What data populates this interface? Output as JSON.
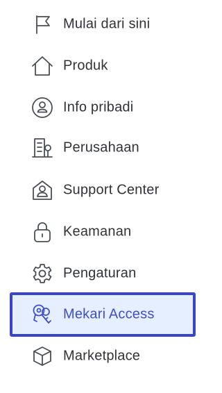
{
  "menu": {
    "items": [
      {
        "label": "Mulai dari sini",
        "icon": "flag-icon"
      },
      {
        "label": "Produk",
        "icon": "home-icon"
      },
      {
        "label": "Info pribadi",
        "icon": "user-circle-icon"
      },
      {
        "label": "Perusahaan",
        "icon": "building-icon"
      },
      {
        "label": "Support Center",
        "icon": "user-house-icon"
      },
      {
        "label": "Keamanan",
        "icon": "lock-icon"
      },
      {
        "label": "Pengaturan",
        "icon": "gear-icon"
      },
      {
        "label": "Mekari Access",
        "icon": "key-search-icon",
        "active": true
      },
      {
        "label": "Marketplace",
        "icon": "cube-icon"
      }
    ]
  },
  "colors": {
    "active_background": "#e6efff",
    "active_border": "#3b45c9",
    "active_text": "#3e4fc7",
    "text": "#2f3338",
    "icon": "#4a4f56"
  }
}
